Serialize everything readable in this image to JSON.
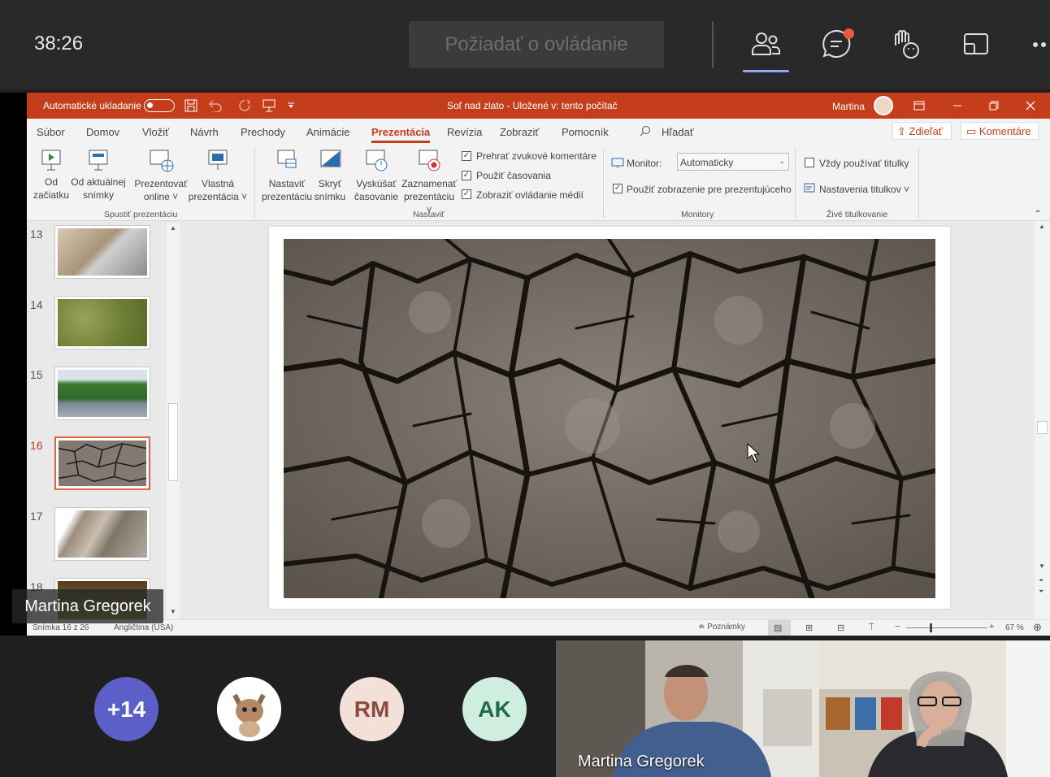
{
  "call": {
    "timer": "38:26",
    "request_control_label": "Požiadať o ovládanie",
    "icons": [
      "people-icon",
      "chat-icon",
      "raise-hand-icon",
      "share-tray-icon",
      "more-icon"
    ]
  },
  "ppt": {
    "autosave_label": "Automatické ukladanie",
    "doc_title": "Soľ nad zlato  -  Uložené v: tento počítač",
    "user": "Martina",
    "tabs": [
      "Súbor",
      "Domov",
      "Vložiť",
      "Návrh",
      "Prechody",
      "Animácie",
      "Prezentácia",
      "Revízia",
      "Zobraziť",
      "Pomocník"
    ],
    "search_label": "Hľadať",
    "share_label": "Zdieľať",
    "comments_label": "Komentáre",
    "ribbon": {
      "b1": [
        "Od",
        "začiatku"
      ],
      "b2": [
        "Od aktuálnej",
        "snímky"
      ],
      "b3": [
        "Prezentovať",
        "online ˅"
      ],
      "b4": [
        "Vlastná",
        "prezentácia ˅"
      ],
      "group1": "Spustiť prezentáciu",
      "b5": [
        "Nastaviť",
        "prezentáciu"
      ],
      "b6": [
        "Skryť",
        "snímku"
      ],
      "b7": [
        "Vyskúšať",
        "časovanie"
      ],
      "b8": [
        "Zaznamenať",
        "prezentáciu ˅"
      ],
      "cb1": "Prehrať zvukové komentáre",
      "cb2": "Použiť časovania",
      "cb3": "Zobraziť ovládanie médií",
      "group2": "Nastaviť",
      "monitor_label": "Monitor:",
      "monitor_value": "Automaticky",
      "presenter_view": "Použiť zobrazenie pre prezentujúceho",
      "group3": "Monitory",
      "always_subtitles": "Vždy používať titulky",
      "subtitle_settings": "Nastavenia titulkov ˅",
      "group4": "Živé titulkovanie"
    },
    "slides": [
      {
        "num": "13"
      },
      {
        "num": "14"
      },
      {
        "num": "15"
      },
      {
        "num": "16",
        "selected": true
      },
      {
        "num": "17"
      },
      {
        "num": "18"
      }
    ],
    "status": {
      "slide_info": "Snímka 16 z 26",
      "language": "Angličtina (USA)",
      "notes": "Poznámky",
      "zoom": "67 %"
    }
  },
  "presenter_name": "Martina Gregorek",
  "participants": [
    {
      "label": "+14",
      "color": "#5b5fc7",
      "text_color": "#ffffff"
    },
    {
      "label": "",
      "color": "#ffffff",
      "text_color": "#000000"
    },
    {
      "label": "RM",
      "color": "#f3e0d8",
      "text_color": "#8a4b3a"
    },
    {
      "label": "AK",
      "color": "#cfeee0",
      "text_color": "#1f6a48"
    }
  ],
  "video_name": "Martina Gregorek"
}
